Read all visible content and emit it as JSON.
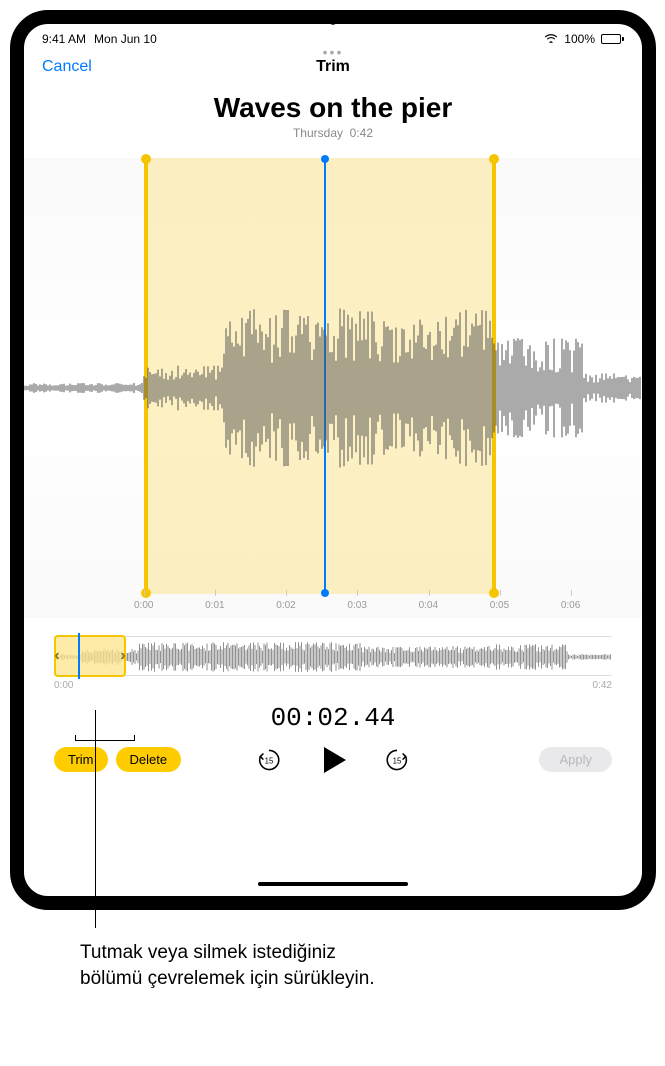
{
  "status": {
    "time": "9:41 AM",
    "date": "Mon Jun 10",
    "battery": "100%"
  },
  "nav": {
    "cancel": "Cancel",
    "title": "Trim"
  },
  "recording": {
    "title": "Waves on the pier",
    "day": "Thursday",
    "duration": "0:42"
  },
  "timeline": {
    "ticks": [
      "0:00",
      "0:01",
      "0:02",
      "0:03",
      "0:04",
      "0:05",
      "0:06"
    ]
  },
  "overview": {
    "start": "0:00",
    "end": "0:42"
  },
  "playback": {
    "current_time": "00:02.44"
  },
  "actions": {
    "trim": "Trim",
    "delete": "Delete",
    "apply": "Apply",
    "skip_back": "15",
    "skip_fwd": "15"
  },
  "callout": "Tutmak veya silmek istediğiniz bölümü çevrelemek için sürükleyin."
}
